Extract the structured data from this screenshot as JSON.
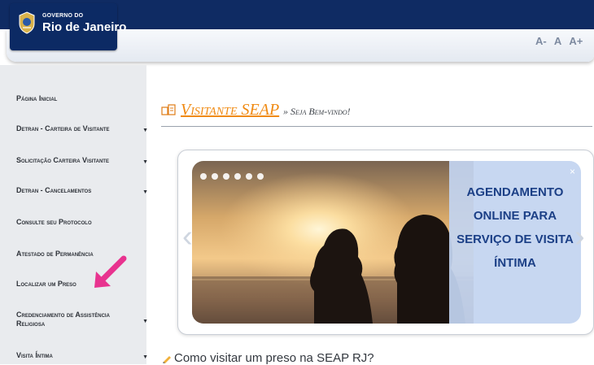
{
  "header": {
    "logo_small": "GOVERNO DO",
    "logo_big": "Rio de Janeiro",
    "font_tools": [
      "A-",
      "A",
      "A+"
    ]
  },
  "sidebar": {
    "items": [
      {
        "label": "Página Inicial",
        "has_submenu": false
      },
      {
        "label": "Detran - Carteira de Visitante",
        "has_submenu": true
      },
      {
        "label": "Solicitação Carteira Visitante",
        "has_submenu": true
      },
      {
        "label": "Detran - Cancelamentos",
        "has_submenu": true
      },
      {
        "label": "Consulte seu Protocolo",
        "has_submenu": false
      },
      {
        "label": "Atestado de Permanência",
        "has_submenu": false
      },
      {
        "label": "Localizar um Preso",
        "has_submenu": false
      },
      {
        "label": "Credenciamento de Assistência Religiosa",
        "has_submenu": true
      },
      {
        "label": "Visita Íntima",
        "has_submenu": true
      }
    ]
  },
  "main": {
    "title": "Visitante SEAP",
    "subtitle": "» Seja Bem-vindo!",
    "slider": {
      "caption": "AGENDAMENTO ONLINE PARA SERVIÇO DE VISITA ÍNTIMA",
      "caption_lines": [
        "AGENDAMENTO",
        "ONLINE PARA",
        "SERVIÇO DE VISITA",
        "ÍNTIMA"
      ],
      "prev": "‹",
      "next": "›",
      "close": "×",
      "dot_count": 6
    },
    "question": "Como visitar um preso na SEAP RJ?"
  },
  "colors": {
    "header_bar": "#0f2b63",
    "title_orange": "#f08a12",
    "caption_blue": "#1b3f86",
    "annotation_pink": "#e8338f",
    "sidebar_bg": "#e9ebee"
  }
}
